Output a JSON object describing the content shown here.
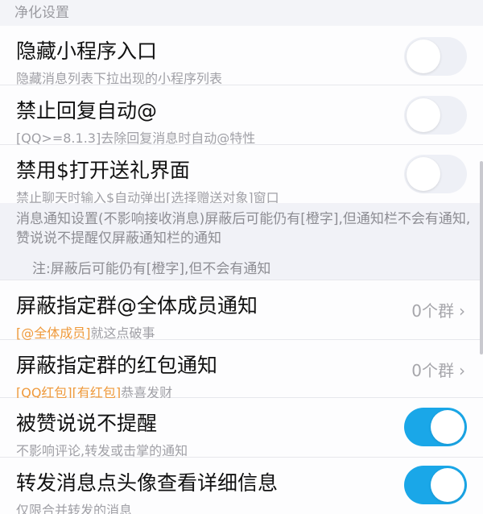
{
  "section": {
    "title": "净化设置"
  },
  "items": [
    {
      "title": "隐藏小程序入口",
      "subtitle": "隐藏消息列表下拉出现的小程序列表",
      "toggle": "off"
    },
    {
      "title": "禁止回复自动@",
      "subtitle": "[QQ>=8.1.3]去除回复消息时自动@特性",
      "toggle": "off"
    },
    {
      "title": "禁用$打开送礼界面",
      "subtitle": "禁止聊天时输入$自动弹出[选择赠送对象]窗口",
      "toggle": "off"
    }
  ],
  "notice": {
    "text": "消息通知设置(不影响接收消息)屏蔽后可能仍有[橙字],但通知栏不会有通知,赞说说不提醒仅屏蔽通知栏的通知",
    "note": "注:屏蔽后可能仍有[橙字],但不会有通知"
  },
  "group_items": [
    {
      "title": "屏蔽指定群@全体成员通知",
      "sub_highlight": "[@全体成员]",
      "sub_rest": "就这点破事",
      "value": "0个群",
      "chevron": "›"
    },
    {
      "title": "屏蔽指定群的红包通知",
      "sub_highlight": "[QQ红包][有红包]",
      "sub_rest": "恭喜发财",
      "value": "0个群",
      "chevron": "›"
    }
  ],
  "toggle_items": [
    {
      "title": "被赞说说不提醒",
      "subtitle": "不影响评论,转发或击掌的通知",
      "toggle": "on"
    },
    {
      "title": "转发消息点头像查看详细信息",
      "subtitle": "仅限合并转发的消息",
      "toggle": "on"
    }
  ],
  "colors": {
    "toggle_on": "#1aa7e8",
    "highlight": "#ef9a3c"
  }
}
